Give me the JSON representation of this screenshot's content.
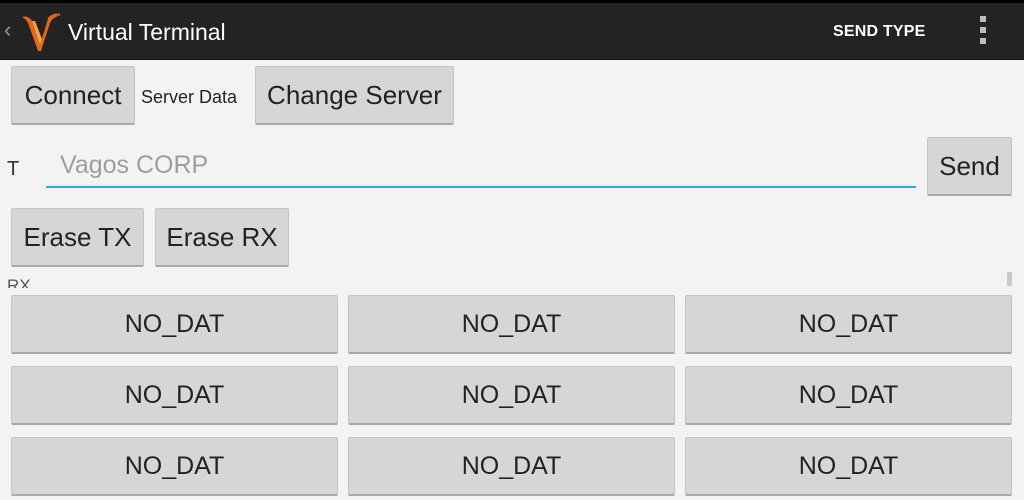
{
  "actionbar": {
    "title": "Virtual Terminal",
    "send_type": "SEND TYPE",
    "back_glyph": "‹",
    "logo_icon": "vagos-logo-icon",
    "menu_icon": "overflow-menu-icon"
  },
  "server": {
    "connect_label": "Connect",
    "server_data_label": "Server Data",
    "change_server_label": "Change Server"
  },
  "transmit": {
    "t_label": "T",
    "input_placeholder": "Vagos CORP",
    "input_value": "",
    "send_label": "Send"
  },
  "erase": {
    "erase_tx_label": "Erase TX",
    "erase_rx_label": "Erase RX"
  },
  "receive": {
    "rx_label": "RX"
  },
  "data_buttons": [
    "NO_DAT",
    "NO_DAT",
    "NO_DAT",
    "NO_DAT",
    "NO_DAT",
    "NO_DAT",
    "NO_DAT",
    "NO_DAT",
    "NO_DAT"
  ],
  "colors": {
    "actionbar_bg": "#232323",
    "button_bg": "#d6d6d6",
    "input_underline": "#33a7d6",
    "page_bg": "#f3f3f3"
  }
}
